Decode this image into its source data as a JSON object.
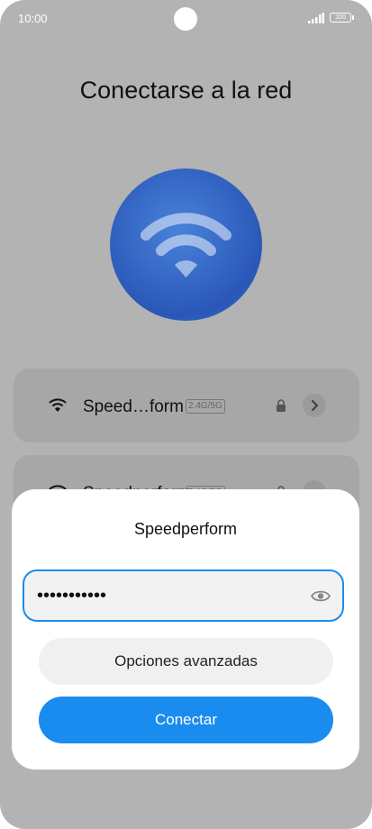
{
  "status_bar": {
    "time": "10:00",
    "battery": "100",
    "icons": [
      "signal-icon",
      "battery-icon"
    ]
  },
  "page": {
    "title": "Conectarse a la red"
  },
  "networks": [
    {
      "name": "Speed…form",
      "band": "2.4G/5G",
      "secured": true,
      "icon": "wifi-icon"
    },
    {
      "name": "Speedperform",
      "band": "2.4G/5G",
      "secured": true,
      "icon": "wifi-icon"
    }
  ],
  "dialog": {
    "title": "Speedperform",
    "password_value": "•••••••••••",
    "advanced_label": "Opciones avanzadas",
    "connect_label": "Conectar"
  },
  "colors": {
    "accent": "#1a8cf0",
    "scrim_background": "#b3b3b3",
    "card_background": "#a7a7a7",
    "dialog_background": "#ffffff"
  }
}
